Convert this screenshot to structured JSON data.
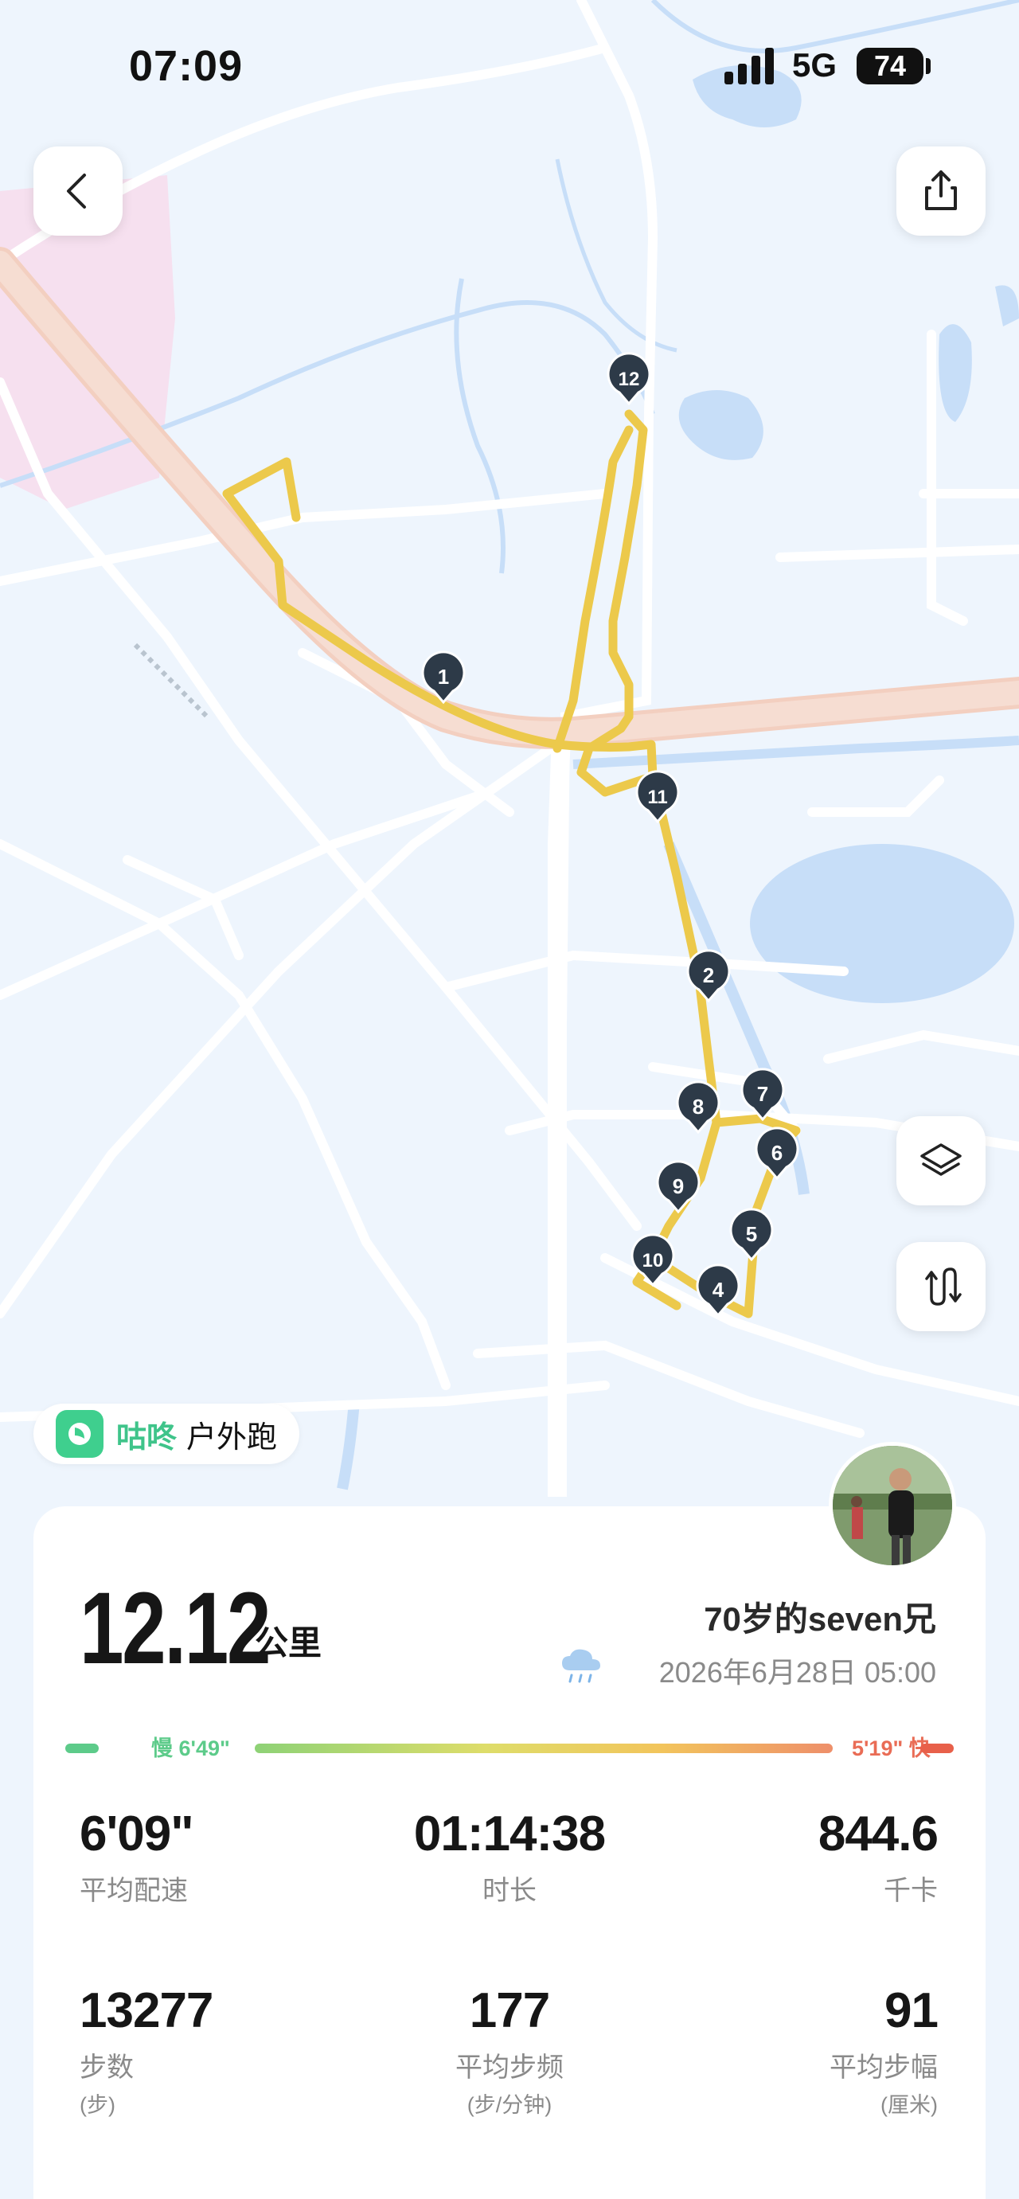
{
  "status_bar": {
    "time": "07:09",
    "network": "5G",
    "battery": "74"
  },
  "map": {
    "markers": [
      "1",
      "2",
      "4",
      "5",
      "6",
      "7",
      "8",
      "9",
      "10",
      "11",
      "12"
    ],
    "colors": {
      "route": "#ecc94b",
      "road": "#ffffff",
      "water": "#c7def8",
      "land": "#eef5fd",
      "highway": "#f2d6c6"
    }
  },
  "controls": {
    "back": "back-icon",
    "share": "share-icon",
    "layers": "layers-icon",
    "route_toggle": "route-icon"
  },
  "brand": {
    "name": "咕咚",
    "sport": "户外跑"
  },
  "summary": {
    "distance": "12.12",
    "distance_unit": "公里",
    "user_name": "70岁的seven兄",
    "datetime": "2026年6月28日 05:00",
    "weather": "rain-cloud-icon"
  },
  "pace_legend": {
    "slow": "慢 6'49\"",
    "fast": "5'19\" 快"
  },
  "stats": [
    {
      "value": "6'09\"",
      "label": "平均配速",
      "unit": ""
    },
    {
      "value": "01:14:38",
      "label": "时长",
      "unit": ""
    },
    {
      "value": "844.6",
      "label": "千卡",
      "unit": ""
    },
    {
      "value": "13277",
      "label": "步数",
      "unit": "(步)"
    },
    {
      "value": "177",
      "label": "平均步频",
      "unit": "(步/分钟)"
    },
    {
      "value": "91",
      "label": "平均步幅",
      "unit": "(厘米)"
    }
  ]
}
